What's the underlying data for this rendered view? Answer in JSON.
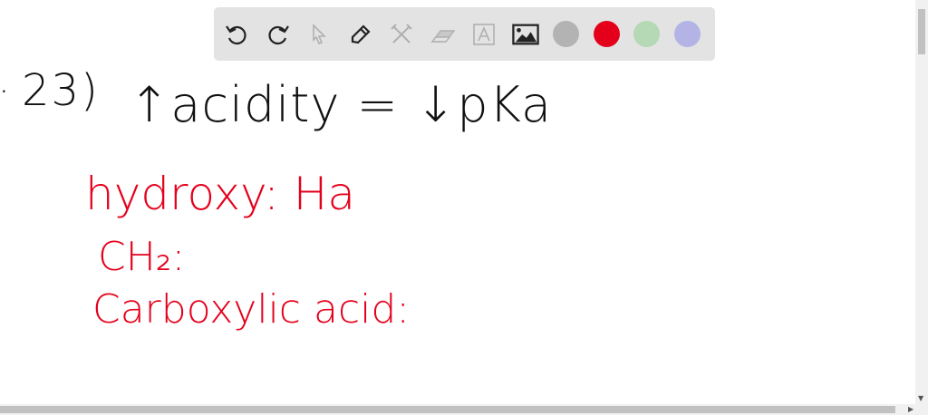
{
  "toolbar": {
    "tools": [
      {
        "name": "undo-icon",
        "glyph": "↺"
      },
      {
        "name": "redo-icon",
        "glyph": "↻"
      },
      {
        "name": "select-icon",
        "glyph": "⇖"
      },
      {
        "name": "pen-icon",
        "glyph": "✎"
      },
      {
        "name": "tools-icon",
        "glyph": "⚒"
      },
      {
        "name": "eraser-icon",
        "glyph": "▱"
      },
      {
        "name": "text-icon",
        "glyph": "A"
      },
      {
        "name": "image-icon",
        "glyph": "▣"
      }
    ],
    "colors": [
      "#b3b3b3",
      "#e4001b",
      "#b5d8b5",
      "#b3b3e6"
    ]
  },
  "canvas": {
    "problem_number": "23)",
    "dot": ".",
    "heading": "↑acidity = ↓pKa",
    "line1": "hydroxy: Ha",
    "line2": "CH₂:",
    "line3": "Carboxylic acid:"
  }
}
